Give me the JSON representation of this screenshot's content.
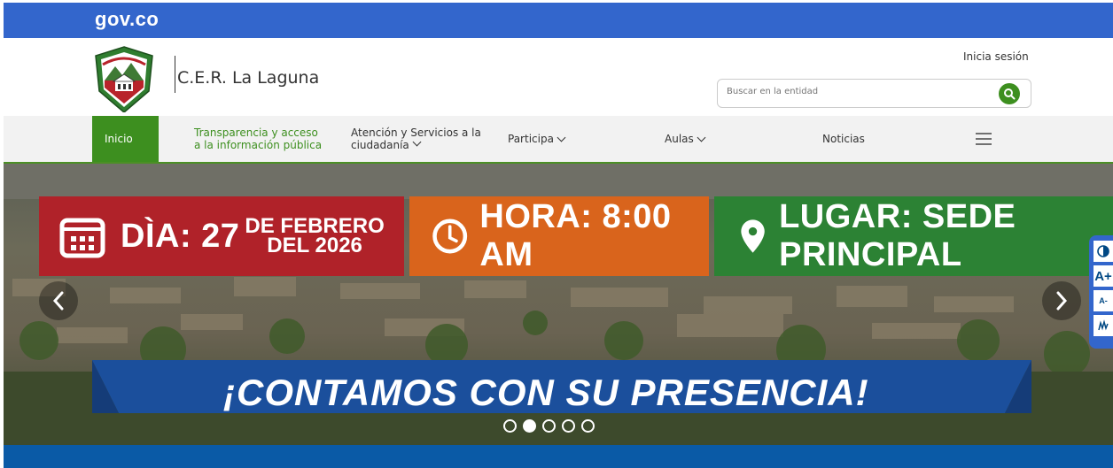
{
  "topbar": {
    "logo_text": "ɡov.co",
    "color": "#3366cc"
  },
  "header": {
    "entity_name": "C.E.R. La Laguna",
    "login_label": "Inicia sesión",
    "search_placeholder": "Buscar en la entidad"
  },
  "nav": {
    "items": [
      {
        "label": "Inicio"
      },
      {
        "label_line1": "Transparencia y acceso",
        "label_line2": "a la información pública"
      },
      {
        "label_line1": "Atención y Servicios a la",
        "label_line2": "ciudadanía"
      },
      {
        "label": "Participa"
      },
      {
        "label": "Aulas"
      },
      {
        "label": "Noticias"
      }
    ],
    "menu_icon": "hamburger-icon",
    "accent_color": "#3d8f1f"
  },
  "hero": {
    "date_label": "DÌA: 27",
    "date_rest_line1": "DE FEBRERO",
    "date_rest_line2": "DEL 2026",
    "time_label": "HORA: 8:00 AM",
    "place_label": "LUGAR: SEDE PRINCIPAL",
    "slogan": "¡CONTAMOS CON SU PRESENCIA!",
    "slides_count": 5,
    "active_slide": 2
  },
  "accessibility": {
    "contrast_icon": "contrast-icon",
    "increase_label": "A+",
    "decrease_label": "A-",
    "sign_icon": "sign-language-icon"
  }
}
